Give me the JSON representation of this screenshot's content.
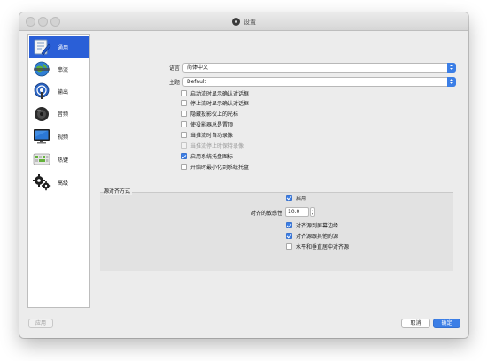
{
  "window": {
    "title": "设置"
  },
  "sidebar": {
    "items": [
      {
        "label": "通用",
        "icon": "general-settings-icon",
        "active": true
      },
      {
        "label": "串流",
        "icon": "stream-globe-icon",
        "active": false
      },
      {
        "label": "输出",
        "icon": "output-broadcast-icon",
        "active": false
      },
      {
        "label": "音频",
        "icon": "audio-speaker-icon",
        "active": false
      },
      {
        "label": "视频",
        "icon": "video-monitor-icon",
        "active": false
      },
      {
        "label": "热键",
        "icon": "hotkeys-keyboard-icon",
        "active": false
      },
      {
        "label": "高级",
        "icon": "advanced-gears-icon",
        "active": false
      }
    ]
  },
  "general": {
    "language_label": "语言",
    "language_value": "简体中文",
    "theme_label": "主题",
    "theme_value": "Default",
    "options": [
      {
        "label": "启动流时显示确认对话框",
        "checked": false,
        "disabled": false
      },
      {
        "label": "停止流时显示确认对话框",
        "checked": false,
        "disabled": false
      },
      {
        "label": "隐藏投影仪上的光标",
        "checked": false,
        "disabled": false
      },
      {
        "label": "使投影器总是置顶",
        "checked": false,
        "disabled": false
      },
      {
        "label": "当推流时自动录像",
        "checked": false,
        "disabled": false
      },
      {
        "label": "当推流停止时保持录像",
        "checked": false,
        "disabled": true
      },
      {
        "label": "启用系统托盘图标",
        "checked": true,
        "disabled": false
      },
      {
        "label": "开始时最小化到系统托盘",
        "checked": false,
        "disabled": false
      }
    ]
  },
  "snapping": {
    "group_title": "源对齐方式",
    "enable_label": "启用",
    "enable_checked": true,
    "sensitivity_label": "对齐的敏感性",
    "sensitivity_value": "10.0",
    "options": [
      {
        "label": "对齐源到屏幕边缘",
        "checked": true
      },
      {
        "label": "对齐源跟其他的源",
        "checked": true
      },
      {
        "label": "水平和垂直居中对齐源",
        "checked": false
      }
    ]
  },
  "buttons": {
    "apply": "应用",
    "cancel": "取消",
    "ok": "确定"
  },
  "colors": {
    "accent": "#3b7ee6",
    "selection": "#2a5fd7",
    "window_bg": "#ececec",
    "group_bg": "#e2e2e2"
  }
}
